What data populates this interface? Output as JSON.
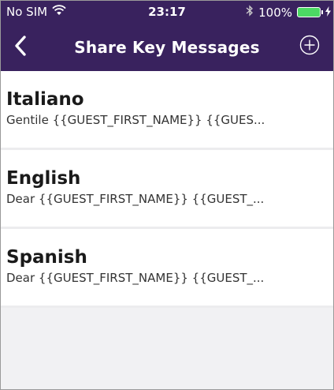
{
  "status_bar": {
    "carrier": "No SIM",
    "time": "23:17",
    "battery": "100%"
  },
  "nav": {
    "title": "Share Key Messages"
  },
  "messages": [
    {
      "language": "Italiano",
      "preview": "Gentile {{GUEST_FIRST_NAME}} {{GUES..."
    },
    {
      "language": "English",
      "preview": "Dear {{GUEST_FIRST_NAME}} {{GUEST_..."
    },
    {
      "language": "Spanish",
      "preview": "Dear {{GUEST_FIRST_NAME}} {{GUEST_..."
    }
  ],
  "colors": {
    "header_bg": "#39225e",
    "battery": "#4cd964",
    "page_bg": "#f1f1f3"
  },
  "icons": [
    "wifi-icon",
    "bluetooth-icon",
    "battery-icon",
    "charging-icon",
    "back-chevron-icon",
    "add-circle-icon"
  ]
}
